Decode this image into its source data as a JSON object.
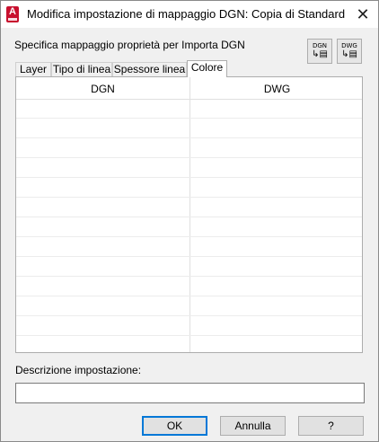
{
  "window": {
    "title": "Modifica impostazione di mappaggio DGN: Copia di Standard",
    "app_icon_letter": "A",
    "close_glyph": "✕"
  },
  "prompt": "Specifica mappaggio proprietà per Importa DGN",
  "icon_buttons": [
    {
      "name": "dgn-mapping-button",
      "label": "DGN",
      "glyph": "↳▤"
    },
    {
      "name": "dwg-mapping-button",
      "label": "DWG",
      "glyph": "↳▤"
    }
  ],
  "tabs": [
    {
      "label": "Layer",
      "active": false
    },
    {
      "label": "Tipo di linea",
      "active": false
    },
    {
      "label": "Spessore linea",
      "active": false
    },
    {
      "label": "Colore",
      "active": true
    }
  ],
  "grid": {
    "columns": [
      "DGN",
      "DWG"
    ],
    "rows": []
  },
  "description": {
    "label": "Descrizione impostazione:",
    "value": ""
  },
  "buttons": {
    "ok": "OK",
    "cancel": "Annulla",
    "help": "?"
  }
}
